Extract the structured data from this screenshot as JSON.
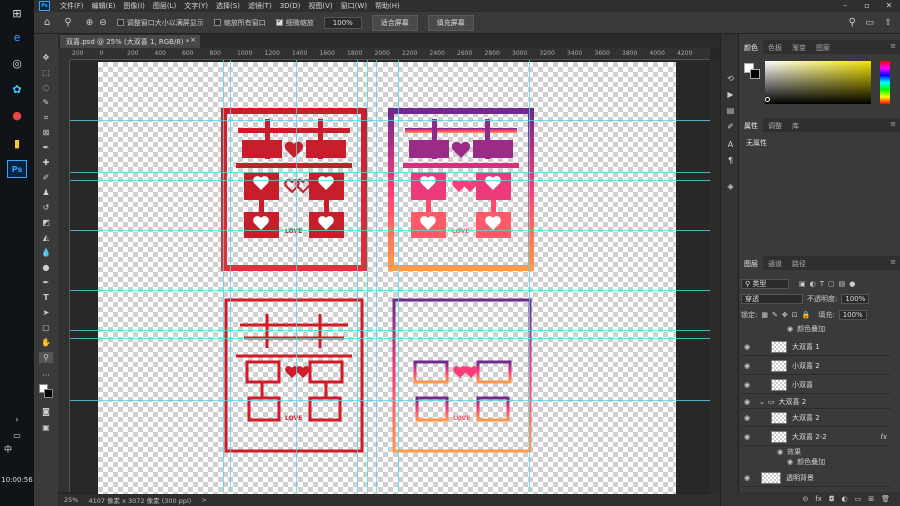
{
  "menubar": {
    "items": [
      "文件(F)",
      "编辑(E)",
      "图像(I)",
      "图层(L)",
      "文字(Y)",
      "选择(S)",
      "滤镜(T)",
      "3D(D)",
      "视图(V)",
      "窗口(W)",
      "帮助(H)"
    ],
    "logo": "Ps"
  },
  "options": {
    "resize_windows": "调整窗口大小以满屏显示",
    "zoom_all": "缩放所有窗口",
    "scrubby_zoom": "细微缩放",
    "zoom_value": "100%",
    "fit_screen": "适合屏幕",
    "fill_screen": "填充屏幕"
  },
  "document": {
    "tab_title": "双喜.psd @ 25% (大双喜 1, RGB/8) *",
    "tab_close": "×"
  },
  "rulers": {
    "top": [
      "200",
      "0",
      "200",
      "400",
      "600",
      "800",
      "1000",
      "1200",
      "1400",
      "1600",
      "1800",
      "2000",
      "2200",
      "2400",
      "2600",
      "2800",
      "3000",
      "3200",
      "3400",
      "3600",
      "3800",
      "4000",
      "4200"
    ]
  },
  "status": {
    "zoom": "25%",
    "doc_size": "4107 像素 x 3072 像素 (300 ppi)",
    "arrow": ">"
  },
  "taskbar": {
    "time": "10:00:56",
    "lang": "中"
  },
  "artwork": {
    "love_text": "LOVE",
    "colors": {
      "red": "#d11a2a",
      "purple": "#6e2a8c",
      "pink": "#ff3a78",
      "orange": "#ff9a4a"
    }
  },
  "panels": {
    "color_tabs": [
      "颜色",
      "色板",
      "渐变",
      "图案"
    ],
    "prop_tabs": [
      "属性",
      "调整",
      "库"
    ],
    "prop_empty": "无属性",
    "layer_tabs": [
      "图层",
      "通道",
      "路径"
    ],
    "kind_filter": "类型",
    "blend_mode": "穿透",
    "opacity_label": "不透明度:",
    "opacity_value": "100%",
    "lock_label": "锁定:",
    "fill_label": "填充:",
    "fill_value": "100%",
    "layers": [
      {
        "name": "颜色叠加",
        "type": "effect"
      },
      {
        "name": "大双喜 1",
        "type": "layer"
      },
      {
        "name": "小双喜 2",
        "type": "layer"
      },
      {
        "name": "小双喜",
        "type": "layer"
      },
      {
        "name": "大双喜 2",
        "type": "group"
      },
      {
        "name": "大双喜 2",
        "type": "layer"
      },
      {
        "name": "大双喜 2-2",
        "type": "layer",
        "fx": "fx"
      },
      {
        "name": "效果",
        "type": "effect"
      },
      {
        "name": "颜色叠加",
        "type": "effect"
      },
      {
        "name": "透明背景",
        "type": "layer"
      }
    ]
  }
}
